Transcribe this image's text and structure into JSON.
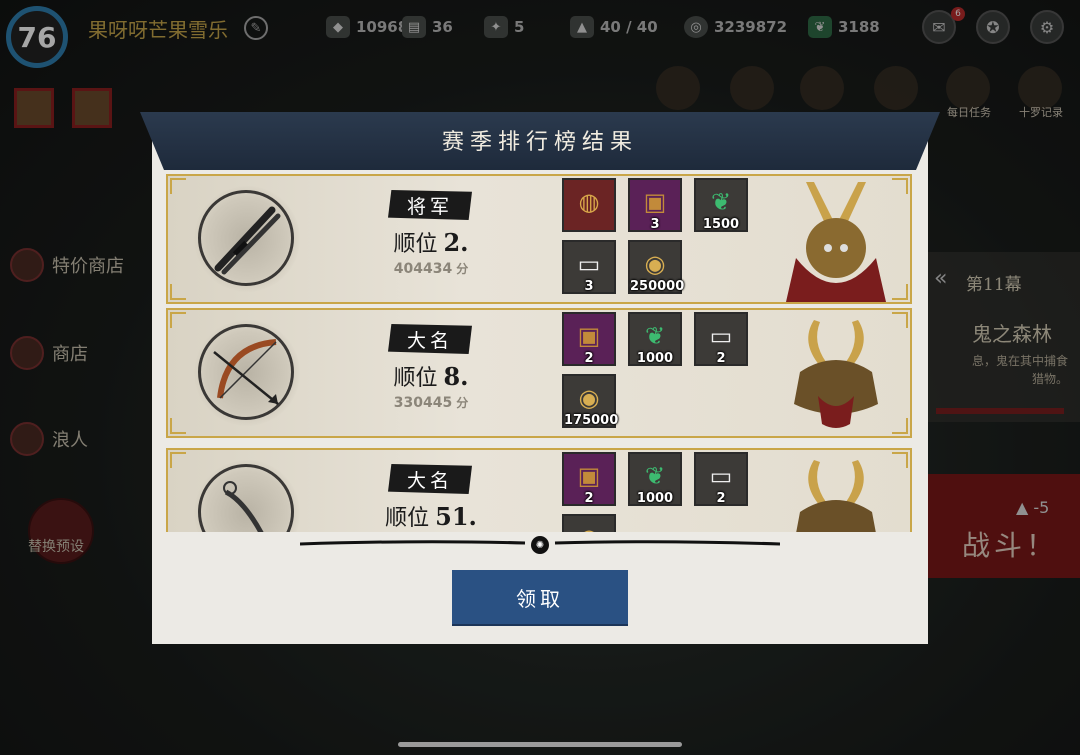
{
  "player": {
    "level": "76",
    "name": "果呀呀芒果雪乐"
  },
  "resources": [
    {
      "icon": "crystal-icon",
      "value": "10968"
    },
    {
      "icon": "ticket-icon",
      "value": "36"
    },
    {
      "icon": "scroll-icon",
      "value": "5"
    },
    {
      "icon": "rice-ball-icon",
      "value": "40 / 40"
    },
    {
      "icon": "coin-icon",
      "value": "3239872"
    },
    {
      "icon": "jade-icon",
      "value": "3188"
    }
  ],
  "mail_badge": "6",
  "top_nav": {
    "daily_tasks": "每日任务",
    "ten_records": "十罗记录"
  },
  "sidebar": {
    "special_shop": "特价商店",
    "shop": "商店",
    "ronin": "浪人",
    "preset": "替换预设"
  },
  "stage": {
    "chapter": "第11幕",
    "name": "鬼之森林",
    "desc_line1": "息，鬼在其中捕食",
    "desc_line2": "猎物。"
  },
  "battle": {
    "label": "战斗！",
    "cost": "-5"
  },
  "modal": {
    "title": "赛季排行榜结果",
    "rank_label": "顺位",
    "score_unit": "分",
    "claim_button": "领取",
    "rows": [
      {
        "title": "将军",
        "rank": "2.",
        "score": "404434",
        "weapon": "katana-icon",
        "rewards": [
          {
            "icon": "collar-icon",
            "count": ""
          },
          {
            "icon": "chest-icon",
            "count": "3"
          },
          {
            "icon": "jade-icon",
            "count": "1500"
          },
          {
            "icon": "scroll-icon",
            "count": "3"
          },
          {
            "icon": "coin-icon",
            "count": "250000"
          }
        ]
      },
      {
        "title": "大名",
        "rank": "8.",
        "score": "330445",
        "weapon": "bow-icon",
        "rewards": [
          {
            "icon": "chest-icon",
            "count": "2"
          },
          {
            "icon": "jade-icon",
            "count": "1000"
          },
          {
            "icon": "scroll-icon",
            "count": "2"
          },
          {
            "icon": "coin-icon",
            "count": "175000"
          }
        ]
      },
      {
        "title": "大名",
        "rank": "51.",
        "score": "",
        "weapon": "kusarigama-icon",
        "rewards": [
          {
            "icon": "chest-icon",
            "count": "2"
          },
          {
            "icon": "jade-icon",
            "count": "1000"
          },
          {
            "icon": "scroll-icon",
            "count": "2"
          }
        ]
      }
    ]
  },
  "colors": {
    "accent_blue": "#2a5183",
    "header_navy": "#1e2a3b",
    "gold_border": "#c9a648",
    "purple_tile": "#5a2157",
    "red_tile": "#6b2424",
    "jade_green": "#2f9a5a",
    "coin_gold": "#c9a24a"
  }
}
